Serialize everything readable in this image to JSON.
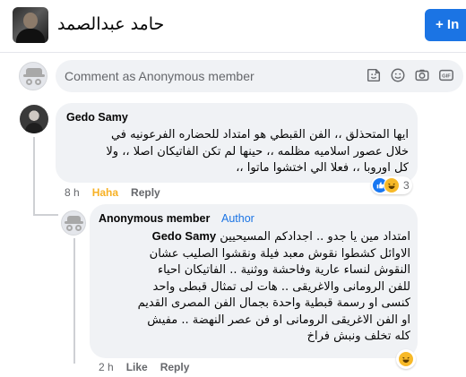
{
  "header": {
    "name": "حامد عبدالصمد",
    "follow_label": "+ In"
  },
  "composer": {
    "placeholder": "Comment as Anonymous member",
    "icons": [
      "sticker-icon",
      "emoji-icon",
      "camera-icon",
      "gif-icon"
    ]
  },
  "comments": [
    {
      "author": "Gedo Samy",
      "lines": [
        "ايها المتحذلق ،، الفن القبطي هو امتداد للحضاره الفرعونيه في",
        "خلال عصور اسلاميه مظلمه ،، حينها لم تكن الفاتيكان اصلا ،، ولا",
        "كل اوروبا ،، فعلا الي اختشوا ماتوا ،،"
      ],
      "time": "8 h",
      "reaction_label": "Haha",
      "reply_label": "Reply",
      "reaction_count": "3"
    },
    {
      "author": "Anonymous member",
      "role": "Author",
      "tag": "Gedo Samy",
      "lines": [
        "امتداد مين يا جدو .. اجدادكم المسيحيين",
        "الاوائل كشطوا نقوش معبد فيلة ونقشوا الصليب عشان",
        "النقوش لنساء عارية وفاحشة ووثنية .. الفاتيكان احياء",
        "للفن الرومانى والاغريقى .. هات لى تمثال قبطى واحد",
        "كنسى او رسمة قبطية واحدة بجمال الفن المصرى القديم",
        "او الفن الاغريقى الرومانى او فن عصر النهضة .. مفيش",
        "كله تخلف ونبش فراخ"
      ],
      "time": "2 h",
      "like_label": "Like",
      "reply_label": "Reply"
    }
  ]
}
